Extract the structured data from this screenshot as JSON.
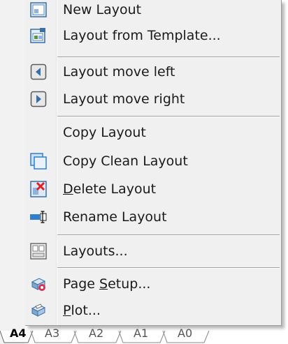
{
  "menu": {
    "items": [
      {
        "label": "New Layout",
        "icon": "new-layout-icon"
      },
      {
        "label": "Layout from Template...",
        "icon": "layout-template-icon"
      },
      {
        "label": "Layout move left",
        "icon": "arrow-left-icon"
      },
      {
        "label": "Layout move right",
        "icon": "arrow-right-icon"
      },
      {
        "label": "Copy Layout",
        "icon": ""
      },
      {
        "label": "Copy Clean Layout",
        "icon": "copy-clean-layout-icon"
      },
      {
        "mnemonic": "D",
        "rest": "elete Layout",
        "icon": "delete-layout-icon"
      },
      {
        "label": "Rename Layout",
        "icon": "rename-layout-icon"
      },
      {
        "label": "Layouts...",
        "icon": "layouts-icon"
      },
      {
        "pre": "Page ",
        "mnemonic": "S",
        "rest": "etup...",
        "icon": "page-setup-icon"
      },
      {
        "mnemonic": "P",
        "rest": "lot...",
        "icon": "plot-icon"
      }
    ]
  },
  "tabs": [
    {
      "label": "A4",
      "active": true
    },
    {
      "label": "A3",
      "active": false
    },
    {
      "label": "A2",
      "active": false
    },
    {
      "label": "A1",
      "active": false
    },
    {
      "label": "A0",
      "active": false
    }
  ],
  "colors": {
    "menu_bg": "#f0f0f0",
    "separator": "#a0a0a0",
    "delete_red": "#e02020",
    "icon_blue": "#2f7fd0"
  }
}
